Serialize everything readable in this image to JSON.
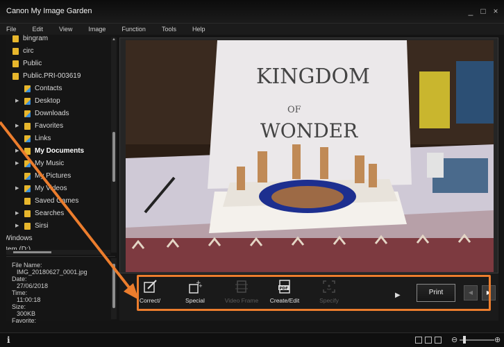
{
  "app": {
    "title": "Canon My Image Garden",
    "window_controls": [
      "_",
      "□",
      "×"
    ]
  },
  "menu": [
    "File",
    "Edit",
    "View",
    "Image",
    "Function",
    "Tools",
    "Help"
  ],
  "tree": [
    {
      "label": "bingram",
      "expandable": false
    },
    {
      "label": "circ",
      "expandable": false
    },
    {
      "label": "Public",
      "expandable": false
    },
    {
      "label": "Public.PRI-003619",
      "expandable": false
    },
    {
      "label": "Contacts",
      "expandable": false
    },
    {
      "label": "Desktop",
      "expandable": true
    },
    {
      "label": "Downloads",
      "expandable": false
    },
    {
      "label": "Favorites",
      "expandable": true
    },
    {
      "label": "Links",
      "expandable": false
    },
    {
      "label": "My Documents",
      "expandable": true,
      "selected": true
    },
    {
      "label": "My Music",
      "expandable": true
    },
    {
      "label": "My Pictures",
      "expandable": false
    },
    {
      "label": "My Videos",
      "expandable": true
    },
    {
      "label": "Saved Games",
      "expandable": false
    },
    {
      "label": "Searches",
      "expandable": true
    },
    {
      "label": "Sirsi",
      "expandable": true
    },
    {
      "label": "Windows",
      "expandable": false
    },
    {
      "label": "stem (D:)",
      "expandable": false
    }
  ],
  "info": {
    "file_name_label": "File Name:",
    "file_name": "IMG_20180627_0001.jpg",
    "date_label": "Date:",
    "date": "27/06/2018",
    "time_label": "Time:",
    "time": "11:00:18",
    "size_label": "Size:",
    "size": "300KB",
    "favorite_label": "Favorite:"
  },
  "toolbar": {
    "tools": [
      {
        "label": "Correct/",
        "icon": "correct-icon",
        "enabled": true
      },
      {
        "label": "Special",
        "icon": "special-filter-icon",
        "enabled": true
      },
      {
        "label": "Video Frame",
        "icon": "video-frame-icon",
        "enabled": false
      },
      {
        "label": "Create/Edit",
        "icon": "pdf-icon",
        "enabled": true
      },
      {
        "label": "Specify",
        "icon": "specify-person-icon",
        "enabled": false
      }
    ],
    "print_label": "Print",
    "pdf_icon_text": "PDF"
  },
  "photo": {
    "sign_lines": [
      "KINGDOM",
      "OF",
      "WONDER"
    ]
  },
  "status": {
    "info_icon": "i"
  },
  "colors": {
    "accent": "#ec7d2d",
    "background": "#141414",
    "folder": "#e7b62c"
  }
}
